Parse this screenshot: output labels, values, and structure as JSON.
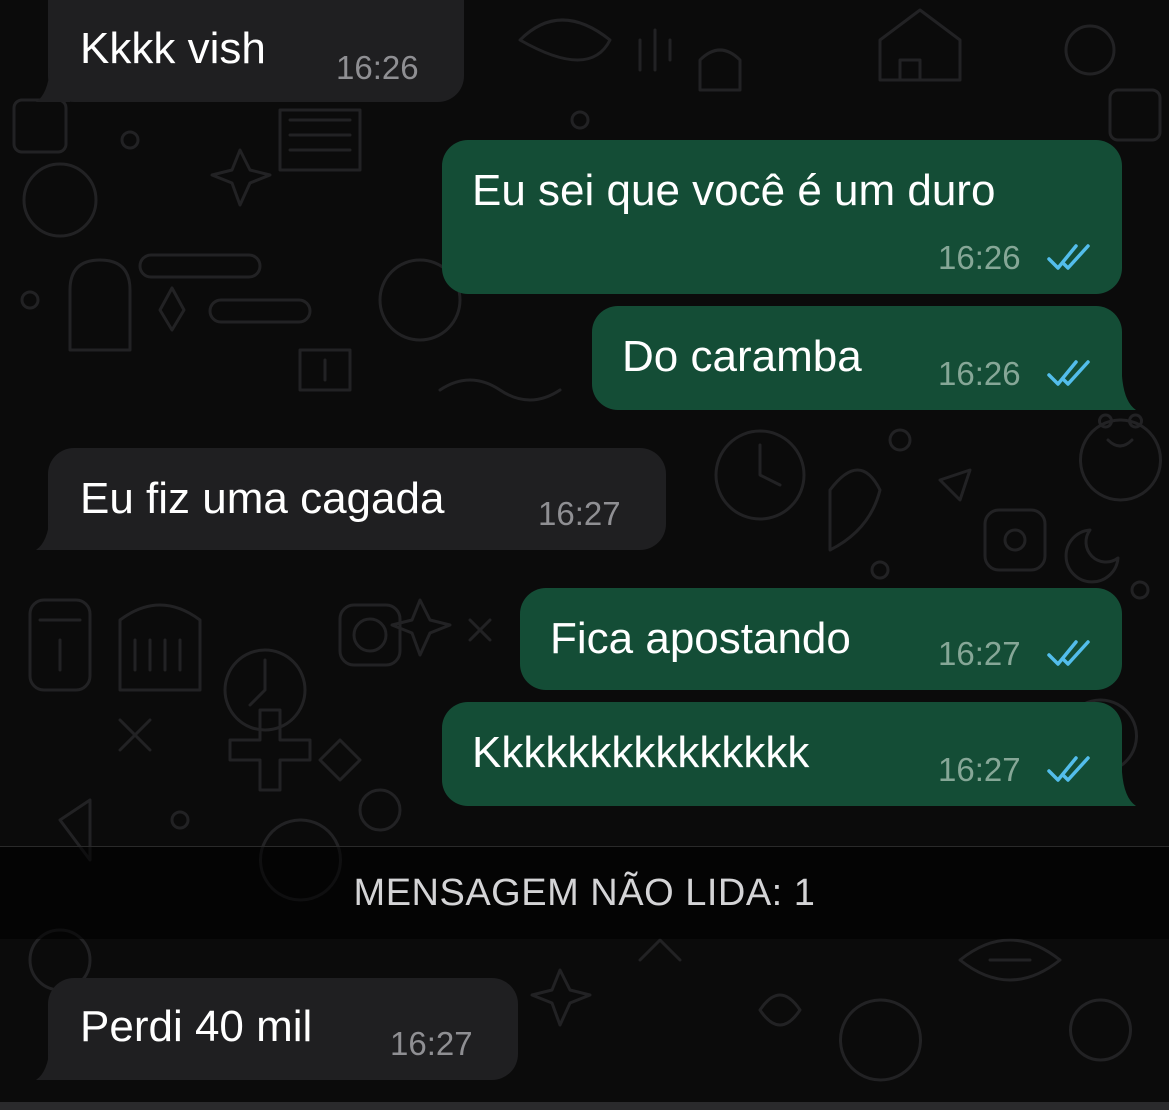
{
  "colors": {
    "incoming_bubble": "#1f1f21",
    "outgoing_bubble": "#144d36",
    "read_ticks": "#53bdeb",
    "wallpaper_bg": "#0b0b0b"
  },
  "icons": {
    "read_status": "double-check-icon"
  },
  "messages": [
    {
      "direction": "incoming",
      "text": "Kkkk vish",
      "time": "16:26"
    },
    {
      "direction": "outgoing",
      "text": "Eu sei que você é um duro",
      "time": "16:26",
      "status": "read"
    },
    {
      "direction": "outgoing",
      "text": "Do caramba",
      "time": "16:26",
      "status": "read"
    },
    {
      "direction": "incoming",
      "text": "Eu fiz uma cagada",
      "time": "16:27"
    },
    {
      "direction": "outgoing",
      "text": "Fica apostando",
      "time": "16:27",
      "status": "read"
    },
    {
      "direction": "outgoing",
      "text": "Kkkkkkkkkkkkkkk",
      "time": "16:27",
      "status": "read"
    },
    {
      "direction": "incoming",
      "text": "Perdi 40 mil",
      "time": "16:27"
    }
  ],
  "unread_divider": {
    "label": "MENSAGEM NÃO LIDA: 1"
  }
}
